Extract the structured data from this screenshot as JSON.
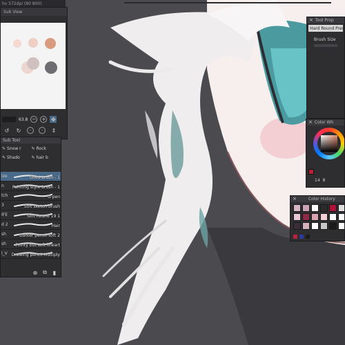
{
  "window": {
    "tab_title": "hv 572dpi (80 800)"
  },
  "subview": {
    "tab_label": "Sub View",
    "zoom_value": "63.8",
    "swatch_colors": [
      "#f3d9cf",
      "#efcfc3",
      "#d99a7e",
      "#ecd6cf",
      "#cfc1bf",
      "#6e6e72"
    ]
  },
  "subtool": {
    "tab_label": "Sub Tool",
    "groups": [
      {
        "label": "Snow r"
      },
      {
        "label": "Rock"
      },
      {
        "label": "Shado"
      },
      {
        "label": "hair b"
      }
    ],
    "brushes": [
      {
        "prefix": "ize",
        "name": "Good brush - 1",
        "selected": true
      },
      {
        "prefix": "n",
        "name": "Painting style brush - 1",
        "selected": false
      },
      {
        "prefix": "tch",
        "name": "G-pen",
        "selected": false
      },
      {
        "prefix": "3",
        "name": "Soft sketch brush",
        "selected": false
      },
      {
        "prefix": "IFE",
        "name": "Soft Round 19 1",
        "selected": false
      },
      {
        "prefix": "d 2",
        "name": "Hair",
        "selected": false
      },
      {
        "prefix": "sh",
        "name": "Darker pencil soft 2",
        "selected": false
      },
      {
        "prefix": "sh",
        "name": "Pointy but soft lineart",
        "selected": false
      },
      {
        "prefix": "l_V",
        "name": "Drawing pencil Multiply",
        "selected": false
      }
    ]
  },
  "toolprop": {
    "title": "Tool Prop",
    "brush_name": "Hard Round Pressure",
    "size_label": "Brush Size"
  },
  "colorwheel": {
    "title": "Color Wh",
    "current_color": "#b8223a",
    "values": [
      "14",
      "8"
    ]
  },
  "colorhist": {
    "title": "Color History",
    "colors": [
      "#d7b6c4",
      "#c9a2b6",
      "#ffffff",
      "#2b2b2b",
      "#b0123a",
      "#e0e0e0",
      "#e6c9d2",
      "#8f2b46",
      "#d9a3b2",
      "#f3cfd8",
      "#ffffff",
      "#ffffff",
      "#3b2c3a",
      "#d4b0bb",
      "#ffffff",
      "#c8c8c8",
      "#1b1b1b",
      "#ffffff"
    ],
    "footer_colors": [
      "#b8223a",
      "#2a3b9c",
      "#1c1c1c"
    ]
  }
}
